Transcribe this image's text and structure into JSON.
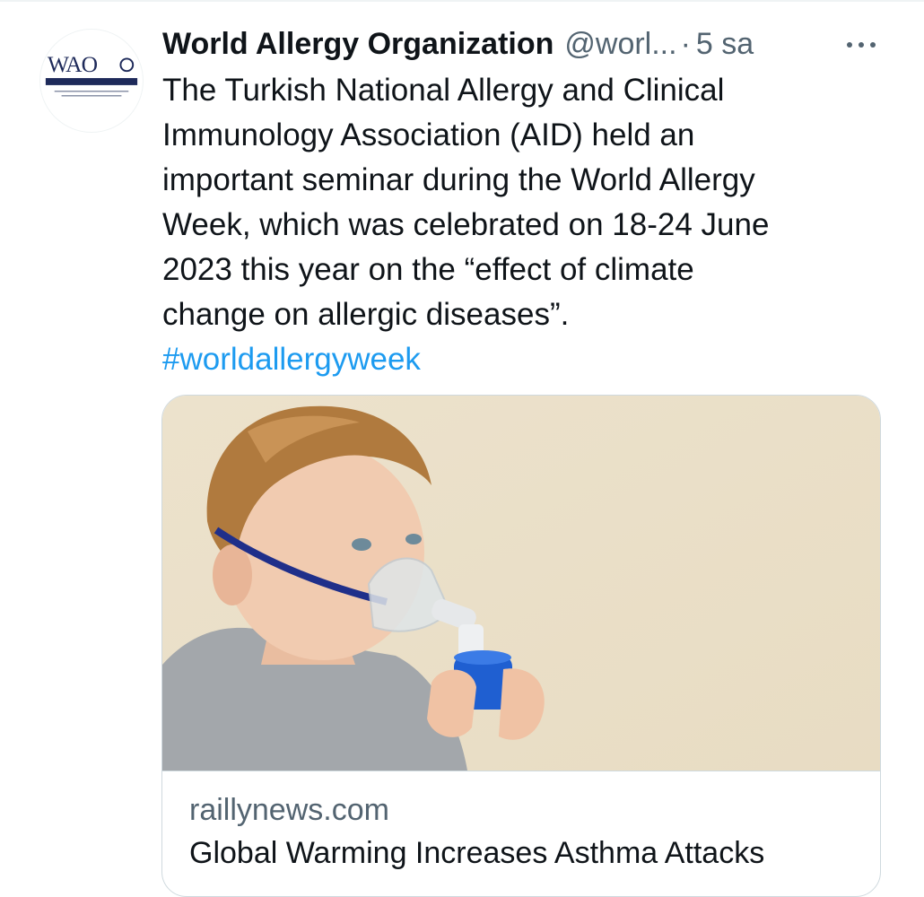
{
  "tweet": {
    "author": {
      "name": "World Allergy Organization",
      "handle": "@worl...",
      "avatar_icon": "wao-logo-avatar",
      "logo_text": "WAO",
      "logo_subtitle": "WORLD ALLERGY ORGANIZATION"
    },
    "separator": "·",
    "timestamp": "5 sa",
    "more_icon": "more-horizontal-icon",
    "text": "The Turkish National Allergy and Clinical\nImmunology Association (AID) held an\nimportant seminar during the World Allergy\nWeek, which was celebrated on 18-24 June\n2023 this year on the “effect of climate\nchange on allergic diseases”.",
    "hashtag": "#worldallergyweek",
    "link_card": {
      "domain": "raillynews.com",
      "title": "Global Warming Increases Asthma Attacks",
      "image_subject": "child-with-nebulizer-mask-photo"
    }
  },
  "colors": {
    "text_primary": "#0f1419",
    "text_secondary": "#536471",
    "link": "#1d9bf0",
    "border": "#cfd9de",
    "logo_navy": "#1e2a5a"
  }
}
